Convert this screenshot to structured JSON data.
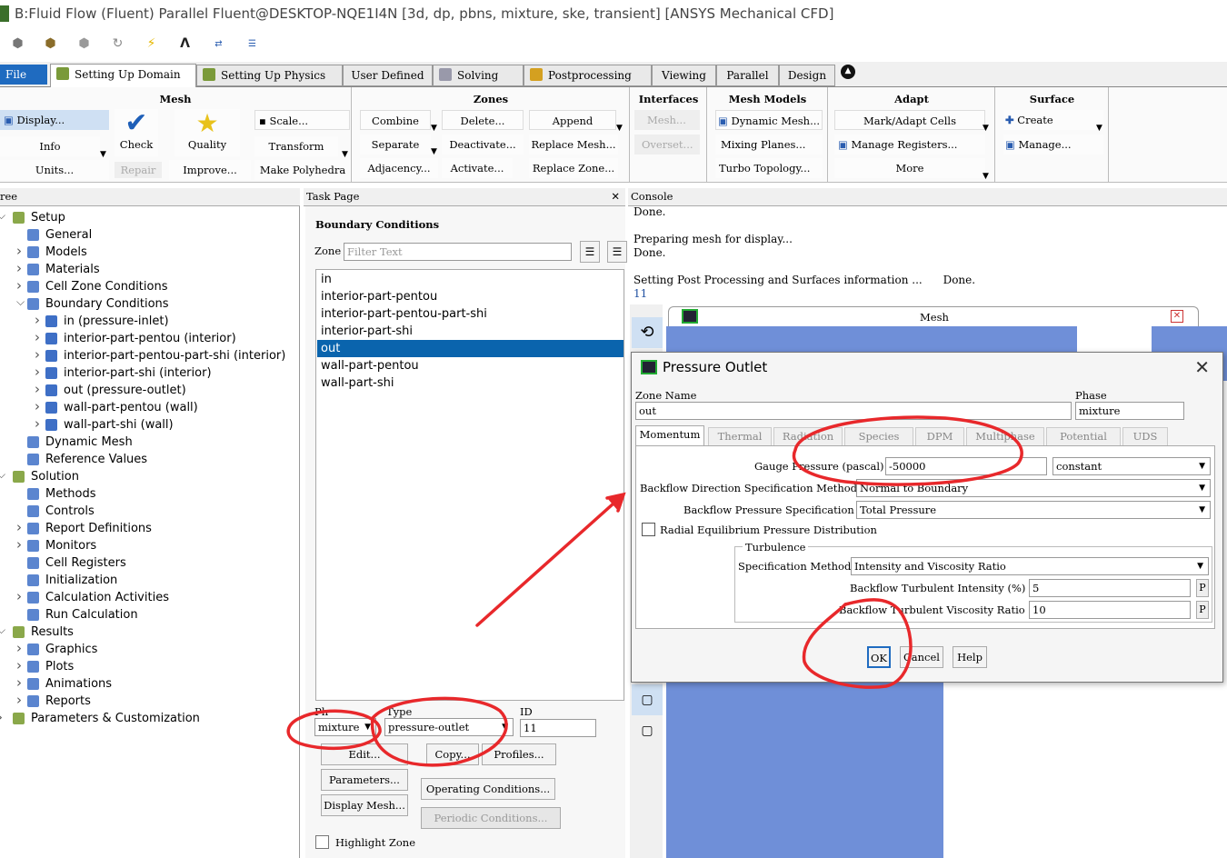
{
  "window": {
    "title": "B:Fluid Flow (Fluent) Parallel Fluent@DESKTOP-NQE1I4N  [3d, dp, pbns, mixture, ske, transient] [ANSYS Mechanical CFD]"
  },
  "ribbon_tabs": [
    "File",
    "Setting Up Domain",
    "Setting Up Physics",
    "User Defined",
    "Solving",
    "Postprocessing",
    "Viewing",
    "Parallel",
    "Design"
  ],
  "ribbon": {
    "mesh": {
      "title": "Mesh",
      "display": "Display...",
      "info": "Info",
      "units": "Units...",
      "check": "Check",
      "repair": "Repair",
      "quality": "Quality",
      "improve": "Improve...",
      "scale": "Scale...",
      "transform": "Transform",
      "make_polyhedra": "Make Polyhedra"
    },
    "zones": {
      "title": "Zones",
      "combine": "Combine",
      "separate": "Separate",
      "adjacency": "Adjacency...",
      "delete": "Delete...",
      "deactivate": "Deactivate...",
      "activate": "Activate...",
      "append": "Append",
      "replace_mesh": "Replace Mesh...",
      "replace_zone": "Replace Zone..."
    },
    "interfaces": {
      "title": "Interfaces",
      "mesh": "Mesh...",
      "overset": "Overset..."
    },
    "mesh_models": {
      "title": "Mesh Models",
      "dynamic_mesh": "Dynamic Mesh...",
      "mixing_planes": "Mixing Planes...",
      "turbo_topology": "Turbo Topology..."
    },
    "adapt": {
      "title": "Adapt",
      "mark_adapt": "Mark/Adapt Cells",
      "manage_registers": "Manage Registers...",
      "more": "More"
    },
    "surface": {
      "title": "Surface",
      "create": "Create",
      "manage": "Manage..."
    }
  },
  "tree": {
    "header": "ree",
    "items": [
      {
        "label": "Setup",
        "level": 0,
        "expand": "open"
      },
      {
        "label": "General",
        "level": 1,
        "expand": "none"
      },
      {
        "label": "Models",
        "level": 1,
        "expand": "closed"
      },
      {
        "label": "Materials",
        "level": 1,
        "expand": "closed"
      },
      {
        "label": "Cell Zone Conditions",
        "level": 1,
        "expand": "closed"
      },
      {
        "label": "Boundary Conditions",
        "level": 1,
        "expand": "open"
      },
      {
        "label": "in (pressure-inlet)",
        "level": 2,
        "expand": "closed"
      },
      {
        "label": "interior-part-pentou (interior)",
        "level": 2,
        "expand": "closed"
      },
      {
        "label": "interior-part-pentou-part-shi (interior)",
        "level": 2,
        "expand": "closed"
      },
      {
        "label": "interior-part-shi (interior)",
        "level": 2,
        "expand": "closed"
      },
      {
        "label": "out (pressure-outlet)",
        "level": 2,
        "expand": "closed"
      },
      {
        "label": "wall-part-pentou (wall)",
        "level": 2,
        "expand": "closed"
      },
      {
        "label": "wall-part-shi (wall)",
        "level": 2,
        "expand": "closed"
      },
      {
        "label": "Dynamic Mesh",
        "level": 1,
        "expand": "none"
      },
      {
        "label": "Reference Values",
        "level": 1,
        "expand": "none"
      },
      {
        "label": "Solution",
        "level": 0,
        "expand": "open"
      },
      {
        "label": "Methods",
        "level": 1,
        "expand": "none"
      },
      {
        "label": "Controls",
        "level": 1,
        "expand": "none"
      },
      {
        "label": "Report Definitions",
        "level": 1,
        "expand": "closed"
      },
      {
        "label": "Monitors",
        "level": 1,
        "expand": "closed"
      },
      {
        "label": "Cell Registers",
        "level": 1,
        "expand": "none"
      },
      {
        "label": "Initialization",
        "level": 1,
        "expand": "none"
      },
      {
        "label": "Calculation Activities",
        "level": 1,
        "expand": "closed"
      },
      {
        "label": "Run Calculation",
        "level": 1,
        "expand": "none"
      },
      {
        "label": "Results",
        "level": 0,
        "expand": "open"
      },
      {
        "label": "Graphics",
        "level": 1,
        "expand": "closed"
      },
      {
        "label": "Plots",
        "level": 1,
        "expand": "closed"
      },
      {
        "label": "Animations",
        "level": 1,
        "expand": "closed"
      },
      {
        "label": "Reports",
        "level": 1,
        "expand": "closed"
      },
      {
        "label": "Parameters & Customization",
        "level": 0,
        "expand": "closed"
      }
    ]
  },
  "task_page": {
    "header": "Task Page",
    "title": "Boundary Conditions",
    "zone_label": "Zone",
    "filter_placeholder": "Filter Text",
    "zones": [
      "in",
      "interior-part-pentou",
      "interior-part-pentou-part-shi",
      "interior-part-shi",
      "out",
      "wall-part-pentou",
      "wall-part-shi"
    ],
    "selected_zone": "out",
    "phase_label": "Ph",
    "phase_value": "mixture",
    "type_label": "Type",
    "type_value": "pressure-outlet",
    "id_label": "ID",
    "id_value": "11",
    "edit": "Edit...",
    "copy": "Copy...",
    "profiles": "Profiles...",
    "parameters": "Parameters...",
    "operating_conditions": "Operating Conditions...",
    "display_mesh": "Display Mesh...",
    "periodic_conditions": "Periodic Conditions...",
    "highlight_zone": "Highlight Zone"
  },
  "console": {
    "header": "Console",
    "lines": [
      "Done.",
      "",
      "Preparing mesh for display...",
      "Done.",
      "",
      "Setting Post Processing and Surfaces information ...      Done.",
      "11"
    ]
  },
  "graphics": {
    "mesh_tab": "Mesh"
  },
  "dialog": {
    "title": "Pressure Outlet",
    "zone_name_label": "Zone Name",
    "zone_name": "out",
    "phase_label": "Phase",
    "phase": "mixture",
    "tabs": [
      "Momentum",
      "Thermal",
      "Radiation",
      "Species",
      "DPM",
      "Multiphase",
      "Potential",
      "UDS"
    ],
    "gauge_pressure_label": "Gauge Pressure (pascal)",
    "gauge_pressure": "-50000",
    "gauge_method": "constant",
    "backflow_dir_label": "Backflow Direction Specification Method",
    "backflow_dir": "Normal to Boundary",
    "backflow_pressure_label": "Backflow Pressure Specification",
    "backflow_pressure": "Total Pressure",
    "radial_eq_label": "Radial Equilibrium Pressure Distribution",
    "turbulence_label": "Turbulence",
    "spec_method_label": "Specification Method",
    "spec_method": "Intensity and Viscosity Ratio",
    "turb_intensity_label": "Backflow Turbulent Intensity (%)",
    "turb_intensity": "5",
    "visc_ratio_label": "Backflow Turbulent Viscosity Ratio",
    "visc_ratio": "10",
    "p_label": "P",
    "ok": "OK",
    "cancel": "Cancel",
    "help": "Help"
  },
  "colors": {
    "accent": "#0a64ad",
    "file_tab": "#1f6bc0",
    "mesh_blue": "#6f8fd8",
    "annotation_red": "#e8282b"
  }
}
